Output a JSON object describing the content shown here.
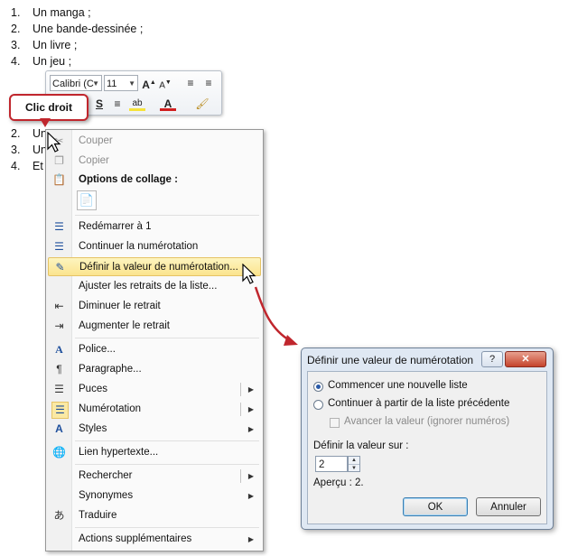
{
  "document": {
    "list_top": [
      "Un manga ;",
      "Une bande-dessinée ;",
      "Un livre ;",
      "Un jeu ;"
    ],
    "list_top_numbers": [
      "1.",
      "2.",
      "3.",
      "4."
    ],
    "list_bottom_partial": [
      "Un",
      "Un",
      "Et"
    ],
    "list_bottom_numbers": [
      "2.",
      "3.",
      "4."
    ]
  },
  "mini_toolbar": {
    "font_value": "Calibri (C",
    "size_value": "11",
    "icons": [
      "grow-font-icon",
      "shrink-font-icon",
      "decrease-indent-icon",
      "increase-indent-icon",
      "strikethrough-icon",
      "center-align-icon",
      "highlight-icon",
      "font-color-icon",
      "format-painter-icon"
    ]
  },
  "callout": {
    "label": "Clic droit"
  },
  "context_menu": {
    "items": [
      {
        "label": "Couper",
        "icon": "cut-icon",
        "state": "disabled"
      },
      {
        "label": "Copier",
        "icon": "copy-icon",
        "state": "disabled"
      },
      {
        "label": "Options de collage :",
        "icon": "paste-options-icon",
        "state": "section"
      },
      {
        "label": "Redémarrer à 1",
        "icon": "restart-numbering-icon"
      },
      {
        "label": "Continuer la numérotation",
        "icon": "continue-numbering-icon"
      },
      {
        "label": "Définir la valeur de numérotation...",
        "icon": "set-value-icon",
        "state": "highlighted"
      },
      {
        "label": "Ajuster les retraits de la liste...",
        "icon": ""
      },
      {
        "label": "Diminuer le retrait",
        "icon": "decrease-indent-icon"
      },
      {
        "label": "Augmenter le retrait",
        "icon": "increase-indent-icon"
      },
      {
        "label": "Police...",
        "icon": "font-icon"
      },
      {
        "label": "Paragraphe...",
        "icon": "paragraph-icon"
      },
      {
        "label": "Puces",
        "icon": "bullets-icon",
        "submenu": true
      },
      {
        "label": "Numérotation",
        "icon": "numbering-icon",
        "submenu": true
      },
      {
        "label": "Styles",
        "icon": "styles-icon",
        "submenu": true
      },
      {
        "label": "Lien hypertexte...",
        "icon": "hyperlink-icon"
      },
      {
        "label": "Rechercher",
        "icon": "",
        "submenu": true
      },
      {
        "label": "Synonymes",
        "icon": "",
        "submenu": true
      },
      {
        "label": "Traduire",
        "icon": "translate-icon"
      },
      {
        "label": "Actions supplémentaires",
        "icon": "",
        "submenu": true
      }
    ]
  },
  "dialog": {
    "title": "Définir une valeur de numérotation",
    "help_label": "?",
    "close_label": "✕",
    "option_new_list": "Commencer une nouvelle liste",
    "option_continue": "Continuer à partir de la liste précédente",
    "option_advance": "Avancer la valeur (ignorer numéros)",
    "value_label": "Définir la valeur sur :",
    "value": "2",
    "preview": "Aperçu : 2.",
    "ok_label": "OK",
    "cancel_label": "Annuler"
  },
  "colors": {
    "accent_red": "#c0262d",
    "menu_highlight": "#fbe48e",
    "dialog_frame": "#dfe8f3"
  }
}
